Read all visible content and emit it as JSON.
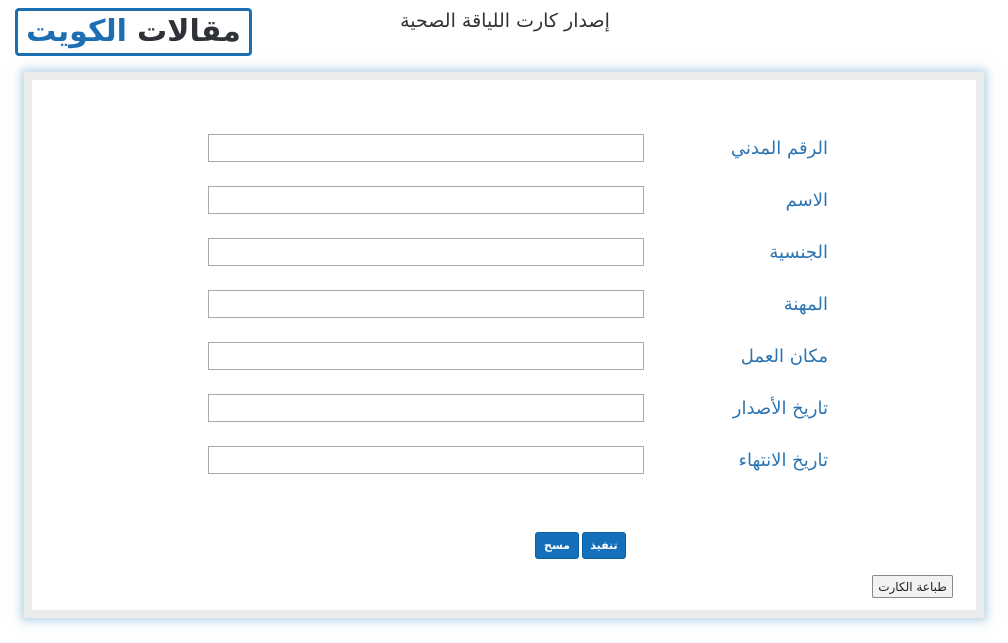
{
  "logo": {
    "word_articles": "مقالات",
    "word_kuwait": "الكويت"
  },
  "page_title": "إصدار كارت اللياقة الصحية",
  "form": {
    "fields": [
      {
        "label": "الرقم المدني",
        "value": ""
      },
      {
        "label": "الاسم",
        "value": ""
      },
      {
        "label": "الجنسية",
        "value": ""
      },
      {
        "label": "المهنة",
        "value": ""
      },
      {
        "label": "مكان العمل",
        "value": ""
      },
      {
        "label": "تاريخ الأصدار",
        "value": ""
      },
      {
        "label": "تاريخ الانتهاء",
        "value": ""
      }
    ],
    "execute_label": "تنفيذ",
    "clear_label": "مسح",
    "print_label": "طباعة الكارت"
  },
  "colors": {
    "brand_blue": "#1d6fb3",
    "label_blue": "#2b74b2",
    "button_blue": "#1470ba"
  }
}
